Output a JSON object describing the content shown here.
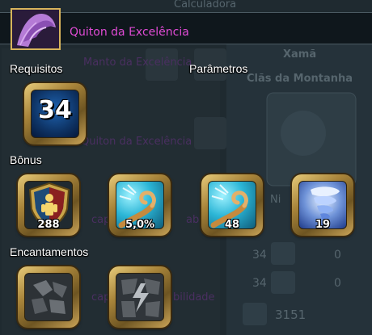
{
  "item": {
    "name": "Quiton da Excelência",
    "icon": "purple-robe-icon"
  },
  "sections": {
    "requirements": "Requisitos",
    "parameters": "Parâmetros",
    "bonus": "Bônus",
    "enchantments": "Encantamentos"
  },
  "requirement_level": "34",
  "bonus_slots": [
    {
      "icon": "defense-shield-icon",
      "value": "288"
    },
    {
      "icon": "wind-swirl-icon",
      "value": "5,0%"
    },
    {
      "icon": "wind-swirl-icon",
      "value": "48"
    },
    {
      "icon": "blue-tornado-icon",
      "value": "19"
    }
  ],
  "enchantment_slots": [
    {
      "icon": "stone-rune-icon"
    },
    {
      "icon": "lightning-rune-icon"
    }
  ],
  "background": {
    "header": "Calculadora",
    "class_name": "Xamã",
    "clan_name": "Clãs da Montanha",
    "item_manto": "Manto da Excelência",
    "item_quiton": "Quiton da Excelência",
    "partial_text_1": "capa",
    "partial_text_2": "abil",
    "partial_text_3": "bilidade",
    "partial_text_4": "capa",
    "partial_text_5": "Ni",
    "stat_row_1_value": "34",
    "stat_row_1_zero": "0",
    "stat_row_2_value": "34",
    "stat_row_2_zero": "0",
    "health_value": "3151"
  }
}
